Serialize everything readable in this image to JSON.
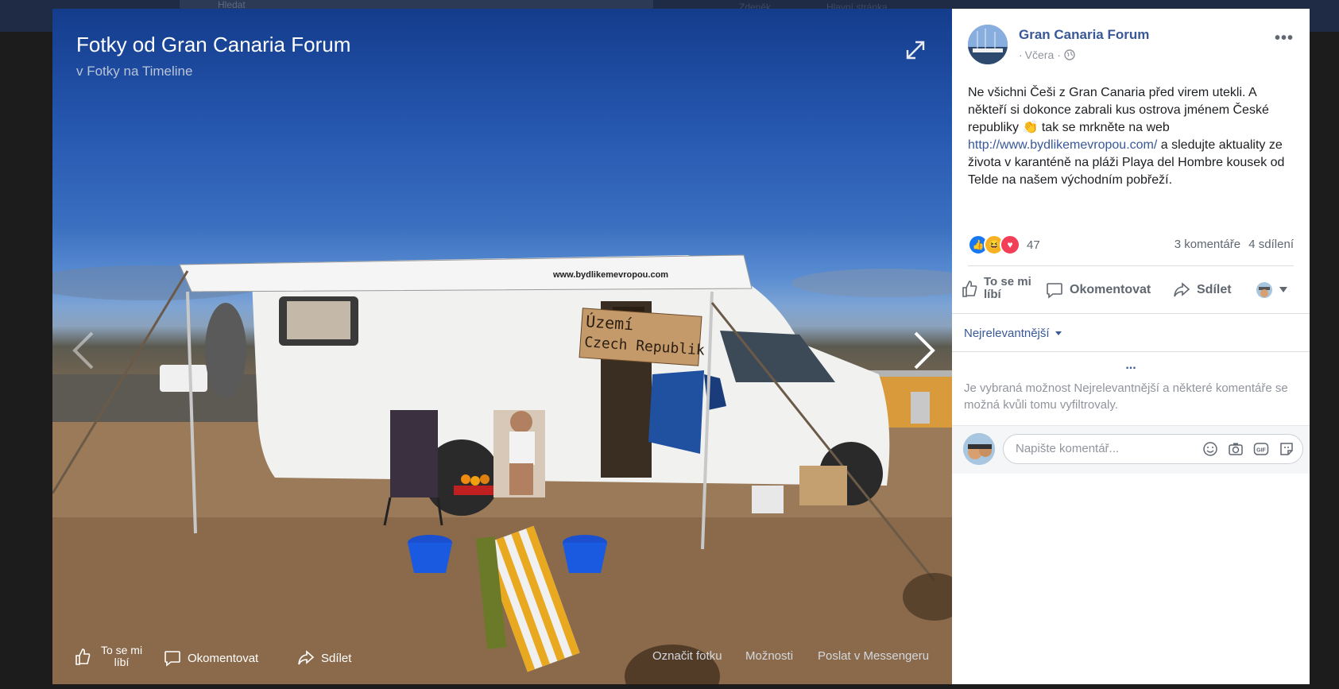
{
  "topbar": {
    "search_placeholder": "Hledat",
    "nav_items": [
      "Zdeněk",
      "Hlavní stránka"
    ]
  },
  "viewer": {
    "title": "Fotky od Gran Canaria Forum",
    "subtitle": "v Fotky na Timeline",
    "photo_sign_line1": "Území",
    "photo_sign_line2": "Czech Republik",
    "photo_awning_text": "www.bydlikemevropou.com",
    "actions": {
      "like": "To se mi líbí",
      "comment": "Okomentovat",
      "share": "Sdílet"
    },
    "links": {
      "tag": "Označit fotku",
      "options": "Možnosti",
      "send": "Poslat v Messengeru"
    }
  },
  "post": {
    "page_name": "Gran Canaria Forum",
    "time": "Včera",
    "text_before_link": "Ne všichni Češi z Gran Canaria před virem utekli. A někteří si dokonce zabrali kus ostrova jménem České republiky 👏 tak se mrkněte na web ",
    "link": "http://www.bydlikemevropou.com/",
    "text_after_link": " a sledujte aktuality ze života v karanténě na pláži Playa del Hombre kousek od Telde na našem východním pobřeží.",
    "reaction_count": "47",
    "comments_count": "3 komentáře",
    "shares_count": "4 sdílení",
    "actions": {
      "like": "To se mi líbí",
      "comment": "Okomentovat",
      "share": "Sdílet"
    },
    "sort_label": "Nejrelevantnější",
    "more_dots": "...",
    "filter_note": "Je vybraná možnost Nejrelevantnější a některé komentáře se možná kvůli tomu vyfiltrovaly.",
    "comment_placeholder": "Napište komentář..."
  },
  "colors": {
    "facebook_blue": "#385898",
    "like_blue": "#1877f2",
    "haha_yellow": "#f7b125",
    "love_red": "#f33e58"
  },
  "icons": [
    "expand-icon",
    "chevron-left-icon",
    "chevron-right-icon",
    "like-icon",
    "comment-icon",
    "share-icon",
    "globe-icon",
    "emoji-icon",
    "camera-icon",
    "gif-icon",
    "sticker-icon"
  ]
}
